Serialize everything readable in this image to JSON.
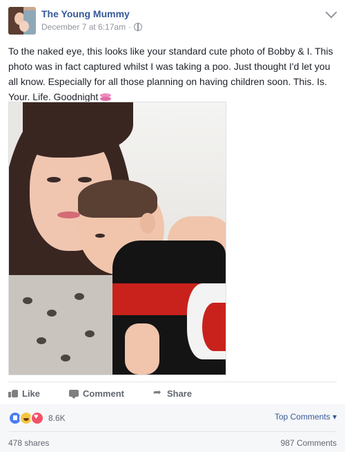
{
  "page": {
    "name": "The Young Mummy",
    "timestamp": "December 7 at 6:17am",
    "separator": "·"
  },
  "post": {
    "text": "To the naked eye, this looks like your standard cute photo of Bobby & I. This photo was in fact captured whilst I was taking a poo. Just thought I'd let you all know. Especially for all those planning on having children soon. This. Is. Your. Life. Goodnight",
    "emoji": "kiss-lips"
  },
  "actions": {
    "like": "Like",
    "comment": "Comment",
    "share": "Share"
  },
  "stats": {
    "reactions": [
      "like",
      "haha",
      "love"
    ],
    "reaction_count": "8.6K",
    "top_comments": "Top Comments",
    "shares": "478 shares",
    "comments": "987 Comments"
  },
  "colors": {
    "link_blue": "#365899",
    "meta_gray": "#90949c"
  }
}
